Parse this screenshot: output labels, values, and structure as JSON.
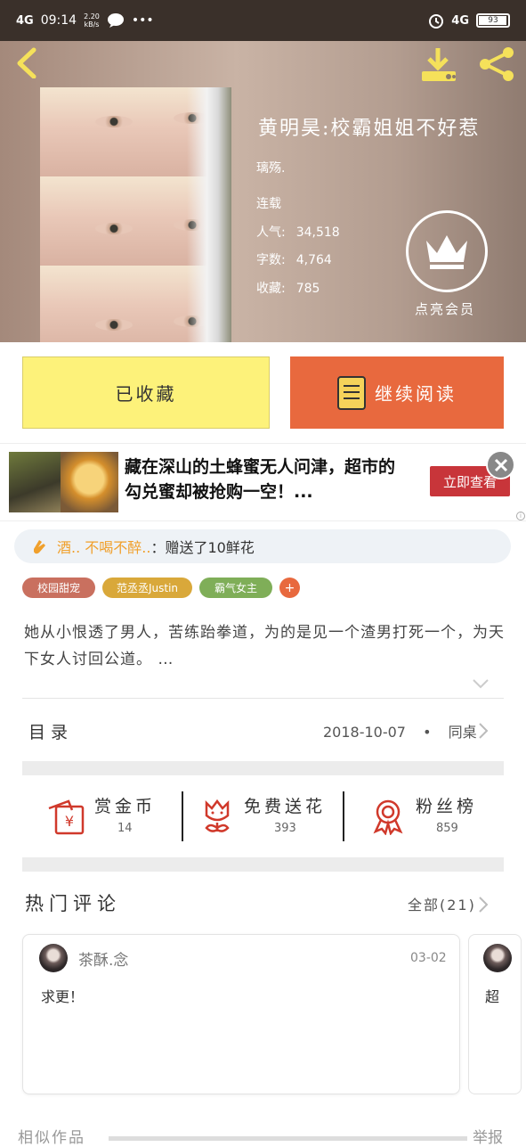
{
  "status_bar": {
    "network_left": "4G",
    "time": "09:14",
    "net_speed_value": "2.20",
    "net_speed_unit": "kB/s",
    "network_right": "4G",
    "battery": "93"
  },
  "book": {
    "title": "黄明昊:校霸姐姐不好惹",
    "author": "璃殇.",
    "status": "连载",
    "popularity_label": "人气:",
    "popularity": "34,518",
    "wordcount_label": "字数:",
    "wordcount": "4,764",
    "favorites_label": "收藏:",
    "favorites": "785",
    "vip_label": "点亮会员"
  },
  "actions": {
    "collected_label": "已收藏",
    "continue_label": "继续阅读"
  },
  "ad": {
    "text": "藏在深山的土蜂蜜无人问津，超市的勾兑蜜却被抢购一空！...",
    "button": "立即查看"
  },
  "gift": {
    "user": "酒.. 不喝不醉..",
    "action": "：赠送了10鲜花"
  },
  "tags": [
    {
      "label": "校园甜宠",
      "color": "#c9705f"
    },
    {
      "label": "范丞丞Justin",
      "color": "#d9a83a"
    },
    {
      "label": "霸气女主",
      "color": "#7fae58"
    },
    {
      "label": "+",
      "color": "#e8693e"
    }
  ],
  "description": "她从小恨透了男人，苦练跆拳道，为的是见一个渣男打死一个，为天下女人讨回公道。 …",
  "toc": {
    "label": "目录",
    "date": "2018-10-07",
    "separator": "•",
    "latest": "同桌"
  },
  "stats": [
    {
      "label": "赏金币",
      "value": "14"
    },
    {
      "label": "免费送花",
      "value": "393"
    },
    {
      "label": "粉丝榜",
      "value": "859"
    }
  ],
  "comments": {
    "title": "热门评论",
    "all_label": "全部(21)",
    "items": [
      {
        "name": "茶酥.念",
        "date": "03-02",
        "text": "求更！"
      },
      {
        "text": "超"
      }
    ]
  },
  "footer": {
    "similar": "相似作品",
    "report": "举报"
  },
  "colors": {
    "accent_orange": "#e8693e",
    "collected_yellow": "#fdf27a",
    "icon_red": "#d0392b"
  }
}
